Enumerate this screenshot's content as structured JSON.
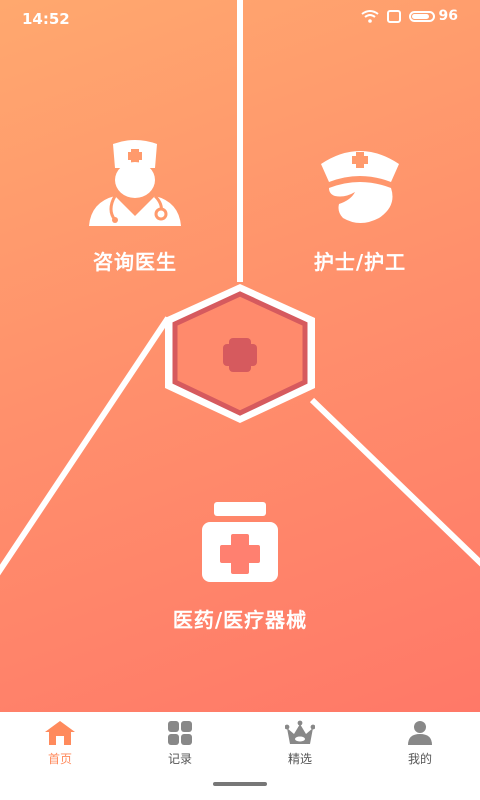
{
  "status_bar": {
    "time": "14:52",
    "battery": "96",
    "battery_level": 0.96
  },
  "features": {
    "doctor": {
      "label": "咨询医生",
      "icon": "doctor-icon"
    },
    "nurse": {
      "label": "护士/护工",
      "icon": "nurse-cap-icon"
    },
    "medicine": {
      "label": "医药/医疗器械",
      "icon": "medicine-bottle-icon"
    },
    "center": {
      "icon": "medical-cross-icon"
    }
  },
  "tabbar": {
    "items": [
      {
        "label": "首页",
        "icon": "home-icon",
        "active": true
      },
      {
        "label": "记录",
        "icon": "grid-icon",
        "active": false
      },
      {
        "label": "精选",
        "icon": "crown-icon",
        "active": false
      },
      {
        "label": "我的",
        "icon": "person-icon",
        "active": false
      }
    ]
  },
  "colors": {
    "gradient_top": "#ffa86e",
    "gradient_bottom": "#ff7467",
    "hexagon_accent": "#d65a5e",
    "tab_active": "#ff8a5c",
    "tab_inactive": "#999999"
  }
}
